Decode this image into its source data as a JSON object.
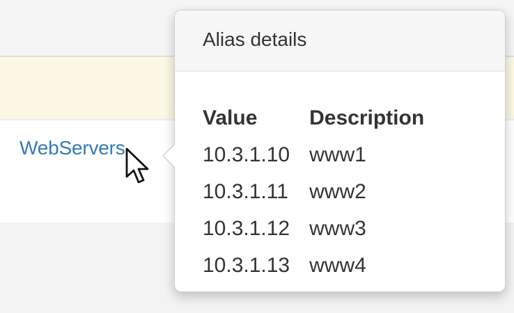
{
  "row": {
    "alias_link": "WebServers"
  },
  "popover": {
    "title": "Alias details",
    "columns": [
      "Value",
      "Description"
    ],
    "rows": [
      {
        "value": "10.3.1.10",
        "description": "www1"
      },
      {
        "value": "10.3.1.11",
        "description": "www2"
      },
      {
        "value": "10.3.1.12",
        "description": "www3"
      },
      {
        "value": "10.3.1.13",
        "description": "www4"
      }
    ]
  },
  "icons": {
    "cursor": "arrow-cursor-icon"
  },
  "colors": {
    "link": "#337ab7",
    "highlight_row": "#fcf8e3",
    "text": "#333333"
  }
}
